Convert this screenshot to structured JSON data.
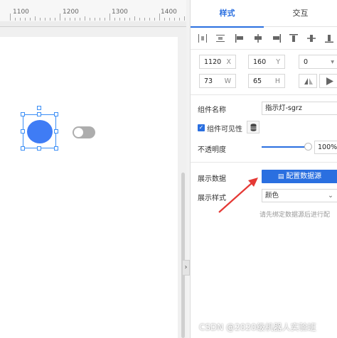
{
  "ruler": {
    "labels": [
      "1100",
      "1200",
      "1300",
      "1400"
    ]
  },
  "tabs": {
    "style": "样式",
    "interaction": "交互"
  },
  "geometry_fields": {
    "x": {
      "value": "1120",
      "unit": "X"
    },
    "y": {
      "value": "160",
      "unit": "Y"
    },
    "rotation": {
      "value": "0"
    },
    "width": {
      "value": "73",
      "unit": "W"
    },
    "height": {
      "value": "65",
      "unit": "H"
    }
  },
  "component": {
    "name_label": "组件名称",
    "name_value": "指示灯-sgrz",
    "visible_label": "组件可见性",
    "visible_checked": true,
    "opacity_label": "不透明度",
    "opacity_value": "100%",
    "opacity_fraction": 1.0
  },
  "data_section": {
    "display_data_label": "展示数据",
    "configure_button": "配置数据源",
    "display_style_label": "展示样式",
    "display_style_value": "颜色",
    "hint": "请先绑定数据源后进行配"
  },
  "canvas": {
    "lamp_color": "#3f7cf5",
    "toggle_color": "#adadad",
    "selection_color": "#3a8ef6"
  },
  "accent_color": "#2a6fe0",
  "annotation_color": "#e53935",
  "watermark": "CSDN @2020级机器人实验班"
}
